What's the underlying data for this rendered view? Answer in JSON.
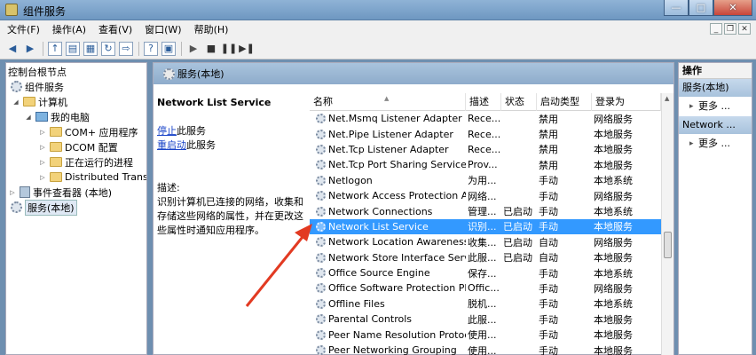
{
  "window": {
    "title": "组件服务",
    "min_label": "—",
    "max_label": "□",
    "close_label": "✕"
  },
  "menu": {
    "items": [
      "文件(F)",
      "操作(A)",
      "查看(V)",
      "窗口(W)",
      "帮助(H)"
    ],
    "mdi": [
      "_",
      "❐",
      "✕"
    ]
  },
  "tree": {
    "root": "控制台根节点",
    "items": [
      {
        "label": "组件服务"
      },
      {
        "label": "计算机"
      },
      {
        "label": "我的电脑"
      },
      {
        "label": "COM+ 应用程序"
      },
      {
        "label": "DCOM 配置"
      },
      {
        "label": "正在运行的进程"
      },
      {
        "label": "Distributed Transac"
      },
      {
        "label": "事件查看器 (本地)"
      },
      {
        "label": "服务(本地)"
      }
    ]
  },
  "main": {
    "header_title": "服务(本地)",
    "service_title": "Network List Service",
    "stop_link": "停止",
    "stop_suffix": "此服务",
    "restart_link": "重启动",
    "restart_suffix": "此服务",
    "desc_label": "描述:",
    "desc_text": "识别计算机已连接的网络，收集和存储这些网络的属性，并在更改这些属性时通知应用程序。"
  },
  "columns": [
    "名称",
    "描述",
    "状态",
    "启动类型",
    "登录为"
  ],
  "services": [
    {
      "name": "Net.Msmq Listener Adapter",
      "desc": "Rece...",
      "status": "",
      "startup": "禁用",
      "logon": "网络服务"
    },
    {
      "name": "Net.Pipe Listener Adapter",
      "desc": "Rece...",
      "status": "",
      "startup": "禁用",
      "logon": "本地服务"
    },
    {
      "name": "Net.Tcp Listener Adapter",
      "desc": "Rece...",
      "status": "",
      "startup": "禁用",
      "logon": "本地服务"
    },
    {
      "name": "Net.Tcp Port Sharing Service",
      "desc": "Prov...",
      "status": "",
      "startup": "禁用",
      "logon": "本地服务"
    },
    {
      "name": "Netlogon",
      "desc": "为用...",
      "status": "",
      "startup": "手动",
      "logon": "本地系统"
    },
    {
      "name": "Network Access Protection Ag...",
      "desc": "网络...",
      "status": "",
      "startup": "手动",
      "logon": "网络服务"
    },
    {
      "name": "Network Connections",
      "desc": "管理...",
      "status": "已启动",
      "startup": "手动",
      "logon": "本地系统"
    },
    {
      "name": "Network List Service",
      "desc": "识别...",
      "status": "已启动",
      "startup": "手动",
      "logon": "本地服务"
    },
    {
      "name": "Network Location Awareness",
      "desc": "收集...",
      "status": "已启动",
      "startup": "自动",
      "logon": "网络服务"
    },
    {
      "name": "Network Store Interface Service",
      "desc": "此服...",
      "status": "已启动",
      "startup": "自动",
      "logon": "本地服务"
    },
    {
      "name": "Office  Source Engine",
      "desc": "保存...",
      "status": "",
      "startup": "手动",
      "logon": "本地系统"
    },
    {
      "name": "Office Software Protection Plat...",
      "desc": "Offic...",
      "status": "",
      "startup": "手动",
      "logon": "网络服务"
    },
    {
      "name": "Offline Files",
      "desc": "脱机...",
      "status": "",
      "startup": "手动",
      "logon": "本地系统"
    },
    {
      "name": "Parental Controls",
      "desc": "此服...",
      "status": "",
      "startup": "手动",
      "logon": "本地服务"
    },
    {
      "name": "Peer Name Resolution Protocol",
      "desc": "使用...",
      "status": "",
      "startup": "手动",
      "logon": "本地服务"
    },
    {
      "name": "Peer Networking Grouping",
      "desc": "使用...",
      "status": "",
      "startup": "手动",
      "logon": "本地服务"
    }
  ],
  "selected_index": 7,
  "actions": {
    "title": "操作",
    "sections": [
      {
        "label": "服务(本地)",
        "more": "更多 ..."
      },
      {
        "label": "Network ...",
        "more": "更多 ..."
      }
    ]
  },
  "colors": {
    "selection": "#3399ff",
    "annotation_arrow": "#e23a22",
    "link": "#1a44c8"
  }
}
